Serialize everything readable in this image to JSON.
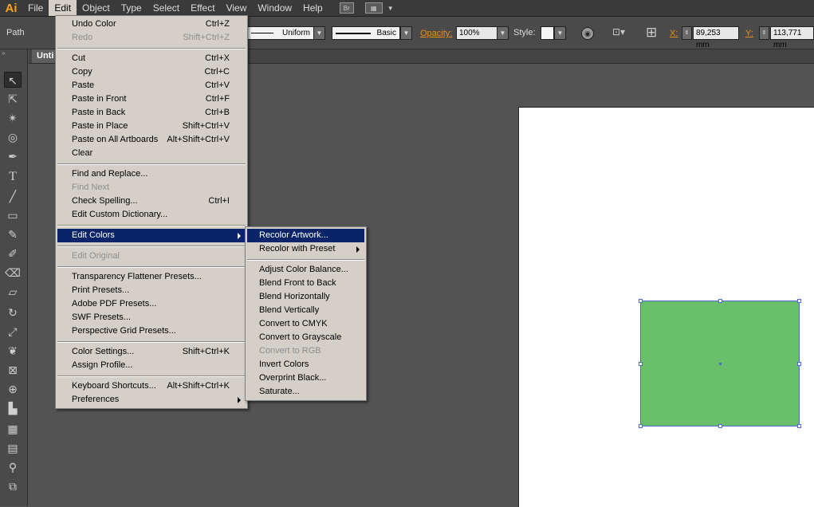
{
  "app": {
    "logo": "Ai"
  },
  "menubar": {
    "items": [
      "File",
      "Edit",
      "Object",
      "Type",
      "Select",
      "Effect",
      "View",
      "Window",
      "Help"
    ],
    "bridge": "Br"
  },
  "controlbar": {
    "selection": "Path",
    "stroke_profile": "Uniform",
    "brush": "Basic",
    "opacity_label": "Opacity:",
    "opacity_value": "100%",
    "style_label": "Style:",
    "x_label": "X:",
    "x_value": "89,253 mm",
    "y_label": "Y:",
    "y_value": "113,771 mm"
  },
  "document": {
    "tab_title": "Unti"
  },
  "colors": {
    "menu_bg": "#d4d0c8",
    "highlight": "#0a246a",
    "shape_fill": "#6abf6a",
    "selection": "#4a6cd4"
  },
  "edit_menu": {
    "items": [
      {
        "label": "Undo Color",
        "shortcut": "Ctrl+Z"
      },
      {
        "label": "Redo",
        "shortcut": "Shift+Ctrl+Z",
        "disabled": true
      },
      {
        "label": "Cut",
        "shortcut": "Ctrl+X"
      },
      {
        "label": "Copy",
        "shortcut": "Ctrl+C"
      },
      {
        "label": "Paste",
        "shortcut": "Ctrl+V"
      },
      {
        "label": "Paste in Front",
        "shortcut": "Ctrl+F"
      },
      {
        "label": "Paste in Back",
        "shortcut": "Ctrl+B"
      },
      {
        "label": "Paste in Place",
        "shortcut": "Shift+Ctrl+V"
      },
      {
        "label": "Paste on All Artboards",
        "shortcut": "Alt+Shift+Ctrl+V"
      },
      {
        "label": "Clear",
        "shortcut": ""
      },
      {
        "label": "Find and Replace...",
        "shortcut": ""
      },
      {
        "label": "Find Next",
        "shortcut": "",
        "disabled": true
      },
      {
        "label": "Check Spelling...",
        "shortcut": "Ctrl+I"
      },
      {
        "label": "Edit Custom Dictionary...",
        "shortcut": ""
      },
      {
        "label": "Edit Colors",
        "shortcut": "",
        "submenu": true
      },
      {
        "label": "Edit Original",
        "shortcut": "",
        "disabled": true
      },
      {
        "label": "Transparency Flattener Presets...",
        "shortcut": ""
      },
      {
        "label": "Print Presets...",
        "shortcut": ""
      },
      {
        "label": "Adobe PDF Presets...",
        "shortcut": ""
      },
      {
        "label": "SWF Presets...",
        "shortcut": ""
      },
      {
        "label": "Perspective Grid Presets...",
        "shortcut": ""
      },
      {
        "label": "Color Settings...",
        "shortcut": "Shift+Ctrl+K"
      },
      {
        "label": "Assign Profile...",
        "shortcut": ""
      },
      {
        "label": "Keyboard Shortcuts...",
        "shortcut": "Alt+Shift+Ctrl+K"
      },
      {
        "label": "Preferences",
        "shortcut": "",
        "submenu": true
      }
    ]
  },
  "edit_colors_submenu": {
    "items": [
      {
        "label": "Recolor Artwork..."
      },
      {
        "label": "Recolor with Preset",
        "submenu": true
      },
      {
        "label": "Adjust Color Balance..."
      },
      {
        "label": "Blend Front to Back"
      },
      {
        "label": "Blend Horizontally"
      },
      {
        "label": "Blend Vertically"
      },
      {
        "label": "Convert to CMYK"
      },
      {
        "label": "Convert to Grayscale"
      },
      {
        "label": "Convert to RGB",
        "disabled": true
      },
      {
        "label": "Invert Colors"
      },
      {
        "label": "Overprint Black..."
      },
      {
        "label": "Saturate..."
      }
    ]
  }
}
